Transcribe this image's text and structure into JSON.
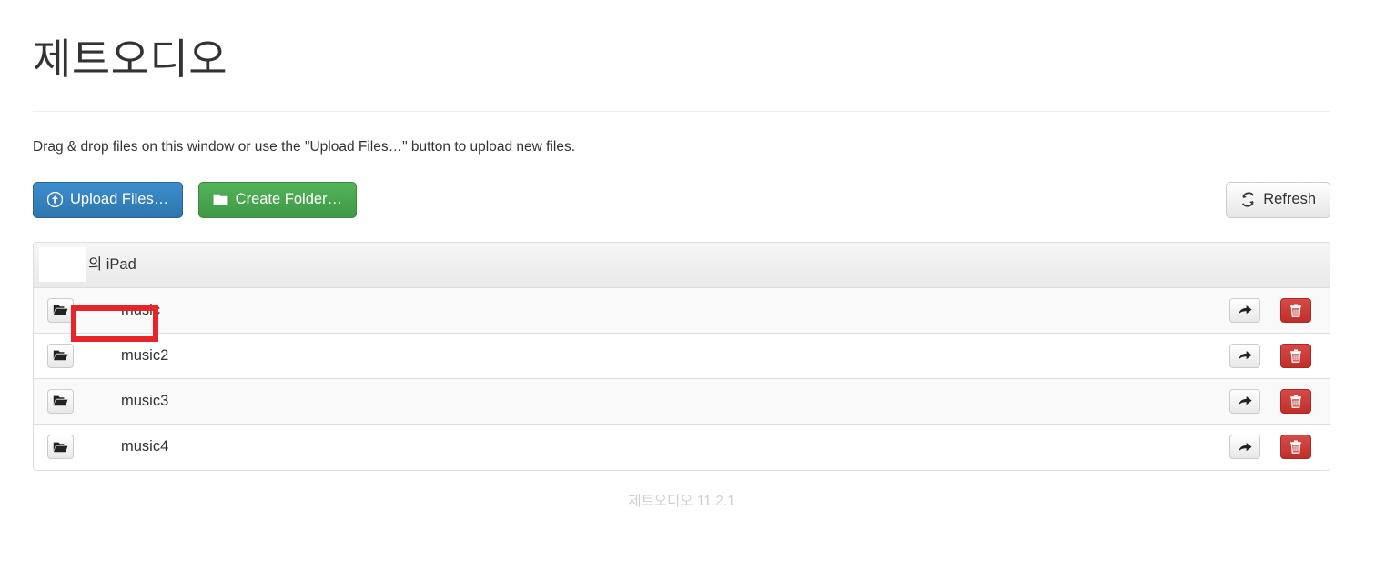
{
  "app": {
    "title": "제트오디오",
    "lead": "Drag & drop files on this window or use the \"Upload Files…\" button to upload new files.",
    "footer": "제트오디오 11.2.1"
  },
  "toolbar": {
    "upload_label": "Upload Files…",
    "create_folder_label": "Create Folder…",
    "refresh_label": "Refresh",
    "upload_icon": "upload-circle-arrow-icon",
    "create_folder_icon": "folder-icon",
    "refresh_icon": "refresh-icon"
  },
  "panel": {
    "header": {
      "device_label": "의 iPad",
      "redacted": true
    },
    "rows": [
      {
        "name": "music",
        "icon": "open-folder-icon",
        "share_icon": "share-arrow-icon",
        "delete_icon": "trash-icon"
      },
      {
        "name": "music2",
        "icon": "open-folder-icon",
        "share_icon": "share-arrow-icon",
        "delete_icon": "trash-icon"
      },
      {
        "name": "music3",
        "icon": "open-folder-icon",
        "share_icon": "share-arrow-icon",
        "delete_icon": "trash-icon"
      },
      {
        "name": "music4",
        "icon": "open-folder-icon",
        "share_icon": "share-arrow-icon",
        "delete_icon": "trash-icon"
      }
    ]
  },
  "annotation": {
    "target": "music",
    "color": "#e8242a"
  },
  "colors": {
    "primary": "#337ab7",
    "success": "#46a04b",
    "danger": "#c9302c",
    "border": "#dddddd",
    "stripe": "#f9f9f9",
    "footer_text": "#cfcfcf"
  }
}
